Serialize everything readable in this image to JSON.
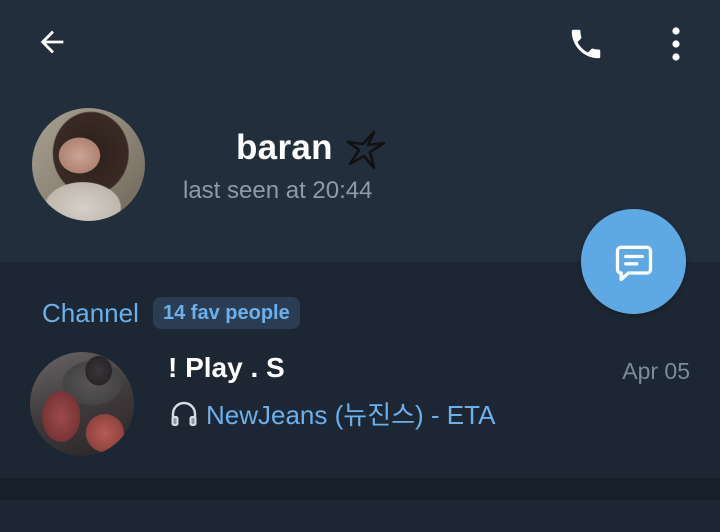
{
  "header": {
    "back_icon": "arrow-left-icon",
    "call_icon": "phone-icon",
    "more_icon": "more-vertical-icon"
  },
  "profile": {
    "name": "baran",
    "status": "last seen at 20:44",
    "emoji_status_icon": "sparkle-star-icon"
  },
  "fab": {
    "icon": "message-icon"
  },
  "channel": {
    "section_label": "Channel",
    "badge": "14 fav people",
    "title": "! Play . S",
    "date": "Apr 05",
    "music_icon": "headphones-icon",
    "subtitle": "NewJeans (뉴진스) - ETA"
  },
  "colors": {
    "header_bg": "#222e3c",
    "body_bg": "#1d2733",
    "accent": "#5ea9e3",
    "link": "#6ab0ec",
    "muted": "#8d9aa8"
  }
}
